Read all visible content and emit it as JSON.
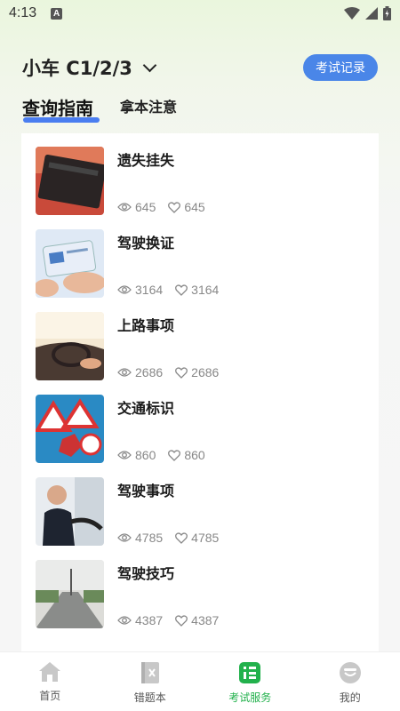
{
  "status_bar": {
    "time": "4:13",
    "notification_badge": "A"
  },
  "header": {
    "car_type": "小车 C1/2/3",
    "record_button": "考试记录"
  },
  "tabs": [
    {
      "label": "查询指南",
      "active": true
    },
    {
      "label": "拿本注意",
      "active": false
    }
  ],
  "items": [
    {
      "title": "遗失挂失",
      "views": "645",
      "likes": "645",
      "thumb_icon": "lost-license-photo"
    },
    {
      "title": "驾驶换证",
      "views": "3164",
      "likes": "3164",
      "thumb_icon": "phone-license-photo"
    },
    {
      "title": "上路事项",
      "views": "2686",
      "likes": "2686",
      "thumb_icon": "car-interior-photo"
    },
    {
      "title": "交通标识",
      "views": "860",
      "likes": "860",
      "thumb_icon": "traffic-signs-photo"
    },
    {
      "title": "驾驶事项",
      "views": "4785",
      "likes": "4785",
      "thumb_icon": "driver-photo"
    },
    {
      "title": "驾驶技巧",
      "views": "4387",
      "likes": "4387",
      "thumb_icon": "road-photo"
    }
  ],
  "bottom_nav": [
    {
      "label": "首页",
      "icon": "home-icon",
      "active": false
    },
    {
      "label": "错题本",
      "icon": "wrong-book-icon",
      "active": false
    },
    {
      "label": "考试服务",
      "icon": "exam-service-icon",
      "active": true
    },
    {
      "label": "我的",
      "icon": "profile-icon",
      "active": false
    }
  ],
  "colors": {
    "accent_blue": "#4a86e8",
    "active_green": "#22b14c"
  }
}
